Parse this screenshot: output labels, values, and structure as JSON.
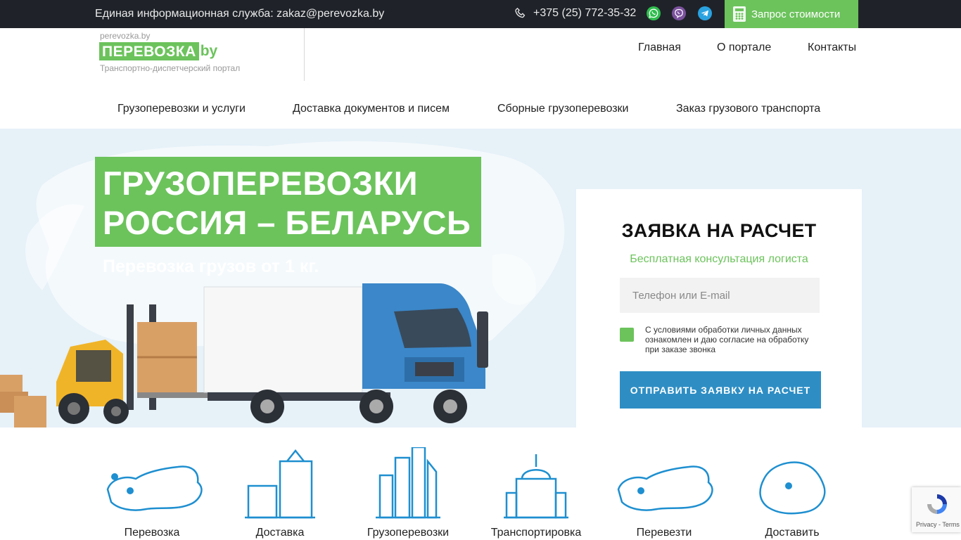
{
  "topbar": {
    "info": "Единая информационная служба: zakaz@perevozka.by",
    "phone": "+375 (25) 772-35-32",
    "quote_button": "Запрос стоимости",
    "messengers": [
      "whatsapp-icon",
      "viber-icon",
      "telegram-icon"
    ]
  },
  "header": {
    "logo_domain": "perevozka.by",
    "logo_word": "ПЕРЕВОЗКА",
    "logo_tld": "by",
    "logo_tagline": "Транспортно-диспетчерский портал",
    "nav": [
      "Главная",
      "О портале",
      "Контакты"
    ]
  },
  "subnav": [
    "Грузоперевозки и услуги",
    "Доставка документов и писем",
    "Сборные грузоперевозки",
    "Заказ грузового транспорта"
  ],
  "hero": {
    "title_line1": "ГРУЗОПЕРЕВОЗКИ",
    "title_line2": "РОССИЯ – БЕЛАРУСЬ",
    "subtitle": "Перевозка грузов от 1 кг."
  },
  "form": {
    "title": "ЗАЯВКА НА РАСЧЕТ",
    "subtitle": "Бесплатная консультация логиста",
    "input_placeholder": "Телефон или E-mail",
    "consent": "С условиями обработки личных данных ознакомлен и даю согласие на обработку при заказе звонка",
    "submit": "ОТПРАВИТЬ ЗАЯВКУ НА РАСЧЕТ"
  },
  "services": [
    "Перевозка",
    "Доставка",
    "Грузоперевозки",
    "Транспортировка",
    "Перевезти",
    "Доставить"
  ],
  "recaptcha": {
    "links": "Privacy - Terms"
  },
  "colors": {
    "green": "#6cc35c",
    "blue": "#2e8ec4",
    "dark": "#1f2329",
    "hero_bg": "#e6f1f8"
  }
}
